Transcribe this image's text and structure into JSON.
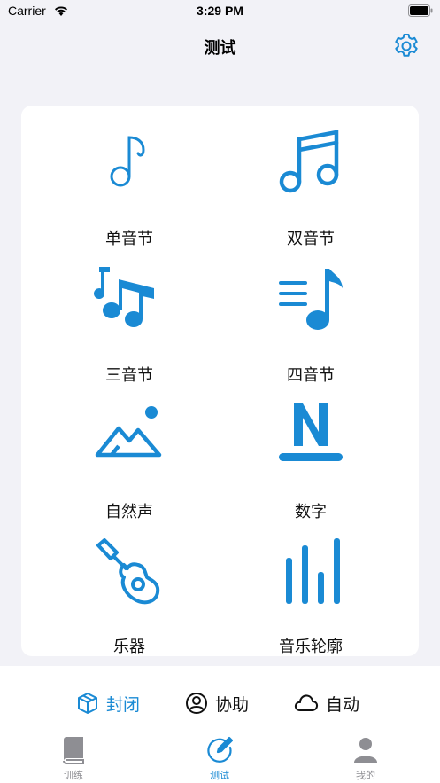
{
  "status_bar": {
    "carrier": "Carrier",
    "time": "3:29 PM"
  },
  "nav": {
    "title": "测试"
  },
  "items": [
    {
      "label": "单音节",
      "icon": "eighth-note-icon"
    },
    {
      "label": "双音节",
      "icon": "beamed-notes-icon"
    },
    {
      "label": "三音节",
      "icon": "triple-notes-icon"
    },
    {
      "label": "四音节",
      "icon": "note-list-icon"
    },
    {
      "label": "自然声",
      "icon": "landscape-icon"
    },
    {
      "label": "数字",
      "icon": "letter-n-icon"
    },
    {
      "label": "乐器",
      "icon": "guitar-icon"
    },
    {
      "label": "音乐轮廓",
      "icon": "bars-icon"
    }
  ],
  "modes": [
    {
      "label": "封闭",
      "icon": "cube-icon",
      "selected": true
    },
    {
      "label": "协助",
      "icon": "person-circle-icon",
      "selected": false
    },
    {
      "label": "自动",
      "icon": "cloud-icon",
      "selected": false
    }
  ],
  "tabs": [
    {
      "label": "训练",
      "icon": "book-icon",
      "selected": false
    },
    {
      "label": "测试",
      "icon": "pencil-circle-icon",
      "selected": true
    },
    {
      "label": "我的",
      "icon": "person-icon",
      "selected": false
    }
  ],
  "colors": {
    "accent": "#1a8ad4",
    "inactive": "#8e8e93",
    "background": "#f2f2f7"
  }
}
